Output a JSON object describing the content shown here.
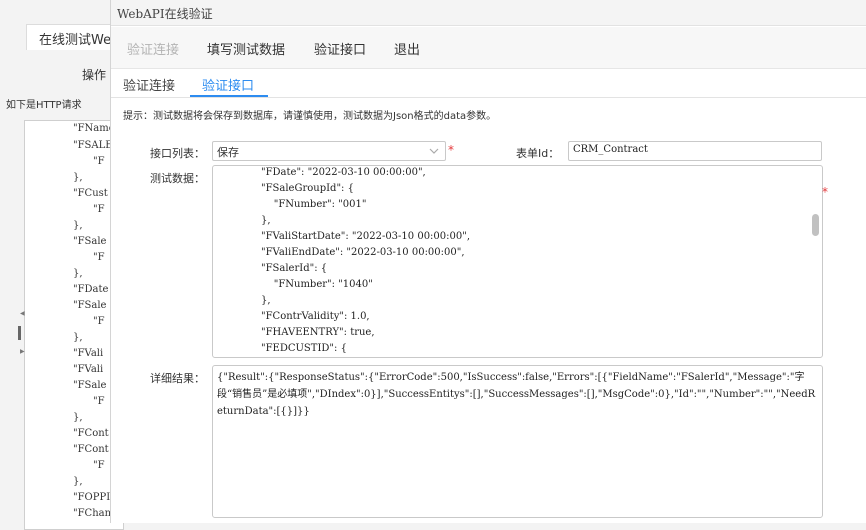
{
  "background": {
    "tab_label": "在线测试We",
    "op_label": "操作",
    "hint": "如下是HTTP请求",
    "code_lines": [
      "\"FName",
      "\"FSALE",
      "\"F",
      "},",
      "\"FCust",
      "\"F",
      "},",
      "\"FSale",
      "\"F",
      "},",
      "\"FDate",
      "\"FSale",
      "\"F",
      "},",
      "\"FVali",
      "\"FVali",
      "\"FSale",
      "\"F",
      "},",
      "\"FCont",
      "\"FCont",
      "\"F",
      "},",
      "\"FOPPI",
      "\"FChan"
    ]
  },
  "dialog": {
    "title": "WebAPI在线验证",
    "menu": [
      "验证连接",
      "填写测试数据",
      "验证接口",
      "退出"
    ],
    "tabs": [
      "验证连接",
      "验证接口"
    ],
    "tip": "提示：测试数据将会保存到数据库，请谨慎使用，测试数据为Json格式的data参数。",
    "labels": {
      "interface_list": "接口列表：",
      "form_id": "表单Id：",
      "test_data": "测试数据：",
      "detail_result": "详细结果："
    },
    "interface_select": {
      "value": "保存"
    },
    "form_id_value": "CRM_Contract",
    "required_mark": "*",
    "test_data_lines": [
      "\"FDate\": \"2022-03-10 00:00:00\",",
      "\"FSaleGroupId\": {",
      "    \"FNumber\": \"001\"",
      "},",
      "\"FValiStartDate\": \"2022-03-10 00:00:00\",",
      "\"FValiEndDate\": \"2022-03-10 00:00:00\",",
      "\"FSalerId\": {",
      "    \"FNumber\": \"1040\"",
      "},",
      "\"FContrValidity\": 1.0,",
      "\"FHAVEENTRY\": true,",
      "\"FEDCUSTID\": {"
    ],
    "result": "{\"Result\":{\"ResponseStatus\":{\"ErrorCode\":500,\"IsSuccess\":false,\"Errors\":[{\"FieldName\":\"FSalerId\",\"Message\":\"字段“销售员”是必填项\",\"DIndex\":0}],\"SuccessEntitys\":[],\"SuccessMessages\":[],\"MsgCode\":0},\"Id\":\"\",\"Number\":\"\",\"NeedReturnData\":[{}]}}"
  },
  "colors": {
    "accent": "#2d8cf0",
    "required": "#e4393c",
    "disabled": "#b4b4b4"
  }
}
